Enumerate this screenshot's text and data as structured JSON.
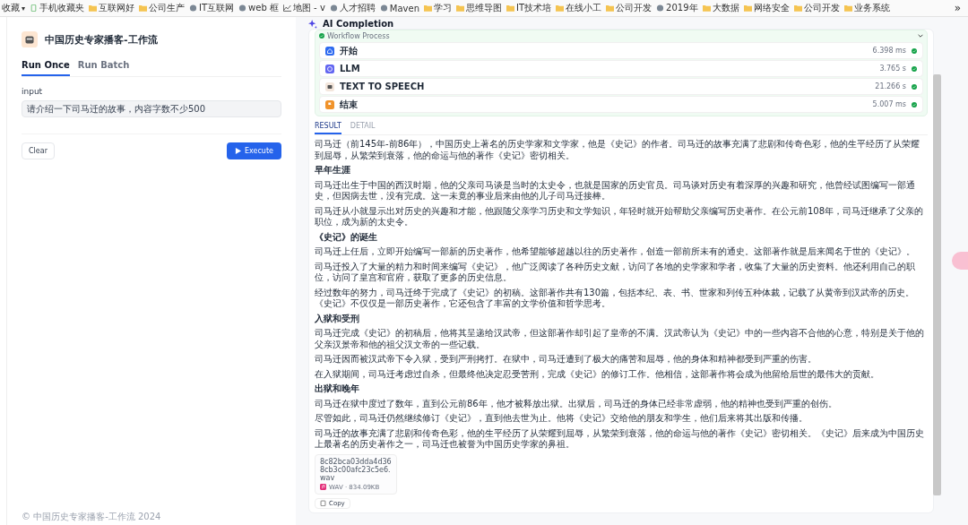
{
  "bookmarks_bar": {
    "items": [
      {
        "label": "收藏",
        "kind": "menu",
        "caret": "▾"
      },
      {
        "label": "手机收藏夹",
        "kind": "phone"
      },
      {
        "label": "互联网好",
        "kind": "folder"
      },
      {
        "label": "公司生产",
        "kind": "folder"
      },
      {
        "label": "IT互联网",
        "kind": "site"
      },
      {
        "label": "web 框",
        "kind": "site"
      },
      {
        "label": "地图 - v",
        "kind": "chart"
      },
      {
        "label": "人才招聘",
        "kind": "site"
      },
      {
        "label": "Maven",
        "kind": "site"
      },
      {
        "label": "学习",
        "kind": "folder"
      },
      {
        "label": "思维导图",
        "kind": "folder"
      },
      {
        "label": "IT技术培",
        "kind": "folder"
      },
      {
        "label": "在线小工",
        "kind": "folder"
      },
      {
        "label": "公司开发",
        "kind": "folder"
      },
      {
        "label": "2019年",
        "kind": "site"
      },
      {
        "label": "大数据",
        "kind": "folder"
      },
      {
        "label": "网络安全",
        "kind": "folder"
      },
      {
        "label": "公司开发",
        "kind": "folder"
      },
      {
        "label": "业务系统",
        "kind": "folder"
      }
    ],
    "overflow": "»"
  },
  "app": {
    "title": "中国历史专家播客-工作流",
    "tabs": [
      {
        "label": "Run Once",
        "selected": true
      },
      {
        "label": "Run Batch",
        "selected": false
      }
    ],
    "input": {
      "label": "input",
      "value": "请介绍一下司马迁的故事，内容字数不少500"
    },
    "buttons": [
      {
        "label": "Clear",
        "kind": "secondary"
      },
      {
        "label": "Execute",
        "kind": "primary"
      }
    ],
    "footer": "© 中国历史专家播客-工作流 2024"
  },
  "completion": {
    "title": "AI Completion",
    "workflow": {
      "title": "Workflow Process",
      "expanded": true,
      "steps": [
        {
          "name": "开始",
          "time": "6.398 ms",
          "kind": "start",
          "done": true
        },
        {
          "name": "LLM",
          "time": "3.765 s",
          "kind": "llm",
          "done": true
        },
        {
          "name": "TEXT TO SPEECH",
          "time": "21.266 s",
          "kind": "tts",
          "done": true
        },
        {
          "name": "结束",
          "time": "5.007 ms",
          "kind": "end",
          "done": true
        }
      ]
    },
    "result_tabs": [
      {
        "label": "RESULT",
        "selected": true
      },
      {
        "label": "DETAIL",
        "selected": false
      }
    ],
    "content": [
      {
        "kind": "p",
        "text": "司马迁（前145年-前86年），中国历史上著名的历史学家和文学家，他是《史记》的作者。司马迁的故事充满了悲剧和传奇色彩，他的生平经历了从荣耀到屈辱，从繁荣到衰落，他的命运与他的著作《史记》密切相关。"
      },
      {
        "kind": "h",
        "text": "早年生涯"
      },
      {
        "kind": "p",
        "text": "司马迁出生于中国的西汉时期，他的父亲司马谈是当时的太史令，也就是国家的历史官员。司马谈对历史有着深厚的兴趣和研究，他曾经试图编写一部通史，但因病去世，没有完成。这一未竟的事业后来由他的儿子司马迁接棒。"
      },
      {
        "kind": "p",
        "text": "司马迁从小就显示出对历史的兴趣和才能，他跟随父亲学习历史和文学知识，年轻时就开始帮助父亲编写历史著作。在公元前108年，司马迁继承了父亲的职位，成为新的太史令。"
      },
      {
        "kind": "h",
        "text": "《史记》的诞生"
      },
      {
        "kind": "p",
        "text": "司马迁上任后，立即开始编写一部新的历史著作，他希望能够超越以往的历史著作，创造一部前所未有的通史。这部著作就是后来闻名于世的《史记》。"
      },
      {
        "kind": "p",
        "text": "司马迁投入了大量的精力和时间来编写《史记》，他广泛阅读了各种历史文献，访问了各地的史学家和学者，收集了大量的历史资料。他还利用自己的职位，访问了皇宫和官府，获取了更多的历史信息。"
      },
      {
        "kind": "p",
        "text": "经过数年的努力，司马迁终于完成了《史记》的初稿。这部著作共有130篇，包括本纪、表、书、世家和列传五种体裁，记载了从黄帝到汉武帝的历史。《史记》不仅仅是一部历史著作，它还包含了丰富的文学价值和哲学思考。"
      },
      {
        "kind": "h",
        "text": "入狱和受刑"
      },
      {
        "kind": "p",
        "text": "司马迁完成《史记》的初稿后，他将其呈递给汉武帝，但这部著作却引起了皇帝的不满。汉武帝认为《史记》中的一些内容不合他的心意，特别是关于他的父亲汉景帝和他的祖父汉文帝的一些记载。"
      },
      {
        "kind": "p",
        "text": "司马迁因而被汉武帝下令入狱，受到严刑拷打。在狱中，司马迁遭到了极大的痛苦和屈辱，他的身体和精神都受到严重的伤害。"
      },
      {
        "kind": "p",
        "text": "在入狱期间，司马迁考虑过自杀，但最终他决定忍受苦刑，完成《史记》的修订工作。他相信，这部著作将会成为他留给后世的最伟大的贡献。"
      },
      {
        "kind": "h",
        "text": "出狱和晚年"
      },
      {
        "kind": "p",
        "text": "司马迁在狱中度过了数年，直到公元前86年，他才被释放出狱。出狱后，司马迁的身体已经非常虚弱，他的精神也受到严重的创伤。"
      },
      {
        "kind": "p",
        "text": "尽管如此，司马迁仍然继续修订《史记》，直到他去世为止。他将《史记》交给他的朋友和学生，他们后来将其出版和传播。"
      },
      {
        "kind": "p",
        "text": "司马迁的故事充满了悲剧和传奇色彩，他的生平经历了从荣耀到屈辱，从繁荣到衰落，他的命运与他的著作《史记》密切相关。《史记》后来成为中国历史上最著名的历史著作之一，司马迁也被誉为中国历史学家的鼻祖。"
      }
    ],
    "attachment": {
      "name": "8c82bca03dda4d368cb3c00afc23c5e6.wav",
      "meta": "WAV · 834.09KB"
    },
    "copy_button": "Copy"
  }
}
